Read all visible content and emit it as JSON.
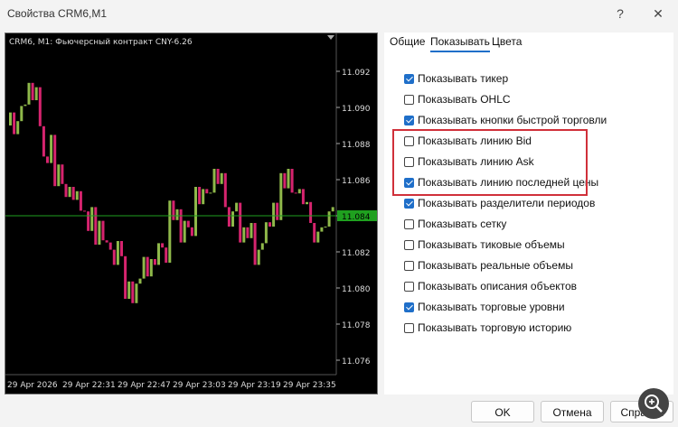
{
  "window": {
    "title": "Свойства CRM6,M1",
    "help_glyph": "?",
    "close_glyph": "✕"
  },
  "chart": {
    "symbol_label": "CRM6, M1:  Фьючерсный контракт CNY-6.26",
    "price_labels": [
      "11.092",
      "11.090",
      "11.088",
      "11.086",
      "11.084",
      "11.082",
      "11.080",
      "11.078",
      "11.076"
    ],
    "current_price": "11.084",
    "time_labels": [
      "29 Apr 2026",
      "29 Apr 22:31",
      "29 Apr 22:47",
      "29 Apr 23:03",
      "29 Apr 23:19",
      "29 Apr 23:35"
    ],
    "colors": {
      "bull": "#8fb84a",
      "bear": "#d6246e",
      "level": "#1fa01f",
      "grid": "#555555"
    }
  },
  "tabs": [
    {
      "label": "Общие",
      "active": false
    },
    {
      "label": "Показывать",
      "active": true
    },
    {
      "label": "Цвета",
      "active": false
    }
  ],
  "options": [
    {
      "label": "Показывать тикер",
      "checked": true
    },
    {
      "label": "Показывать OHLC",
      "checked": false
    },
    {
      "label": "Показывать кнопки быстрой торговли",
      "checked": true
    },
    {
      "label": "Показывать линию Bid",
      "checked": false
    },
    {
      "label": "Показывать линию Ask",
      "checked": false
    },
    {
      "label": "Показывать линию последней цены",
      "checked": true
    },
    {
      "label": "Показывать разделители периодов",
      "checked": true
    },
    {
      "label": "Показывать сетку",
      "checked": false
    },
    {
      "label": "Показывать тиковые объемы",
      "checked": false
    },
    {
      "label": "Показывать реальные объемы",
      "checked": false
    },
    {
      "label": "Показывать описания объектов",
      "checked": false
    },
    {
      "label": "Показывать торговые уровни",
      "checked": true
    },
    {
      "label": "Показывать торговую историю",
      "checked": false
    }
  ],
  "buttons": {
    "ok": "OK",
    "cancel": "Отмена",
    "help": "Справка"
  }
}
